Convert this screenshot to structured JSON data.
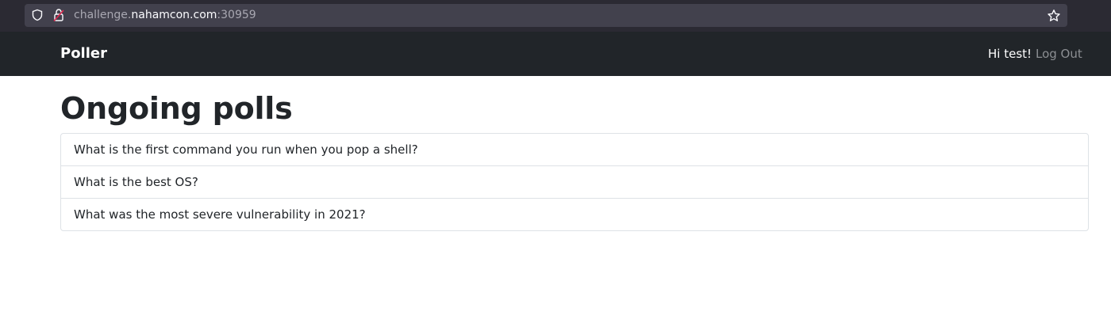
{
  "browser": {
    "url_prefix": "challenge.",
    "url_domain": "nahamcon.com",
    "url_suffix": ":30959",
    "icons": [
      "shield-icon",
      "lock-icon",
      "star-icon"
    ]
  },
  "navbar": {
    "brand": "Poller",
    "greeting": "Hi test!",
    "logout_label": "Log Out"
  },
  "main": {
    "title": "Ongoing polls",
    "polls": [
      "What is the first command you run when you pop a shell?",
      "What is the best OS?",
      "What was the most severe vulnerability in 2021?"
    ]
  },
  "colors": {
    "navbar_bg": "#212529",
    "browser_bg": "#2b2a33",
    "border": "#dee2e6",
    "text": "#212529",
    "muted_link": "#8c8f93"
  }
}
